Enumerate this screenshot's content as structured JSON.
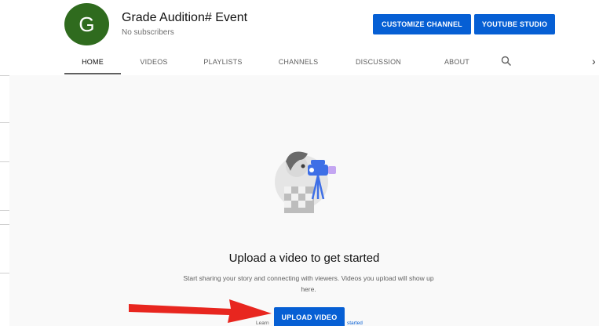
{
  "channel": {
    "avatar_letter": "G",
    "name": "Grade Audition# Event",
    "subscribers": "No subscribers",
    "avatar_color": "#2f6b1e"
  },
  "header_buttons": {
    "customize": "CUSTOMIZE CHANNEL",
    "studio": "YOUTUBE STUDIO"
  },
  "tabs": [
    "HOME",
    "VIDEOS",
    "PLAYLISTS",
    "CHANNELS",
    "DISCUSSION",
    "ABOUT"
  ],
  "active_tab": "HOME",
  "tabs_next_glyph": "›",
  "empty_state": {
    "title": "Upload a video to get started",
    "description": "Start sharing your story and connecting with viewers. Videos you upload will show up here.",
    "upload_button": "UPLOAD VIDEO",
    "learn_left": "Learn",
    "learn_right": "started"
  },
  "colors": {
    "accent_blue": "#065fd4",
    "arrow_red": "#e8261f"
  }
}
